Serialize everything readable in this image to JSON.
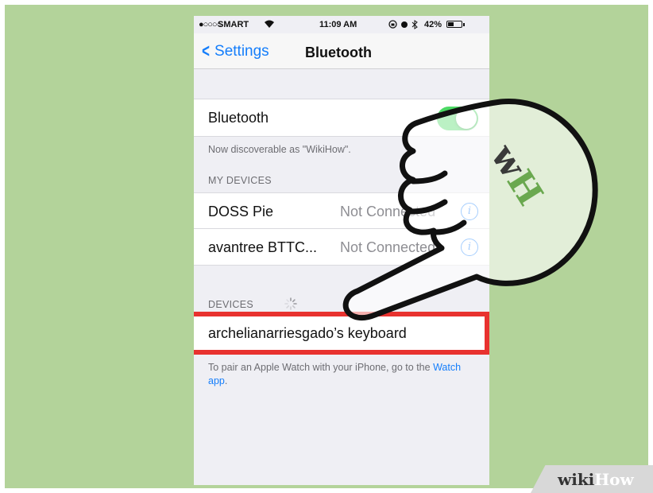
{
  "status_bar": {
    "signal": "●○○○○",
    "carrier": "SMART",
    "time": "11:09 AM",
    "battery": "42%"
  },
  "navbar": {
    "back_label": "Settings",
    "title": "Bluetooth"
  },
  "bluetooth_row": {
    "label": "Bluetooth",
    "toggle_on": true
  },
  "discoverable_text": "Now discoverable as \"WikiHow\".",
  "my_devices": {
    "header": "MY DEVICES",
    "items": [
      {
        "name": "DOSS Pie",
        "status": "Not Connected"
      },
      {
        "name": "avantree BTTC...",
        "status": "Not Connected"
      }
    ]
  },
  "devices": {
    "header": "DEVICES",
    "items": [
      {
        "name": "archelianarriesgado’s keyboard"
      }
    ]
  },
  "footer": {
    "text": "To pair an Apple Watch with your iPhone, go to the",
    "link": "Watch app",
    "end": "."
  },
  "hand_badge": "wH",
  "watermark": {
    "wiki": "wiki",
    "how": "How"
  },
  "colors": {
    "background": "#b3d39a",
    "ios_blue": "#157efb",
    "toggle_green": "#4cd964",
    "highlight_red": "#e8322f"
  }
}
